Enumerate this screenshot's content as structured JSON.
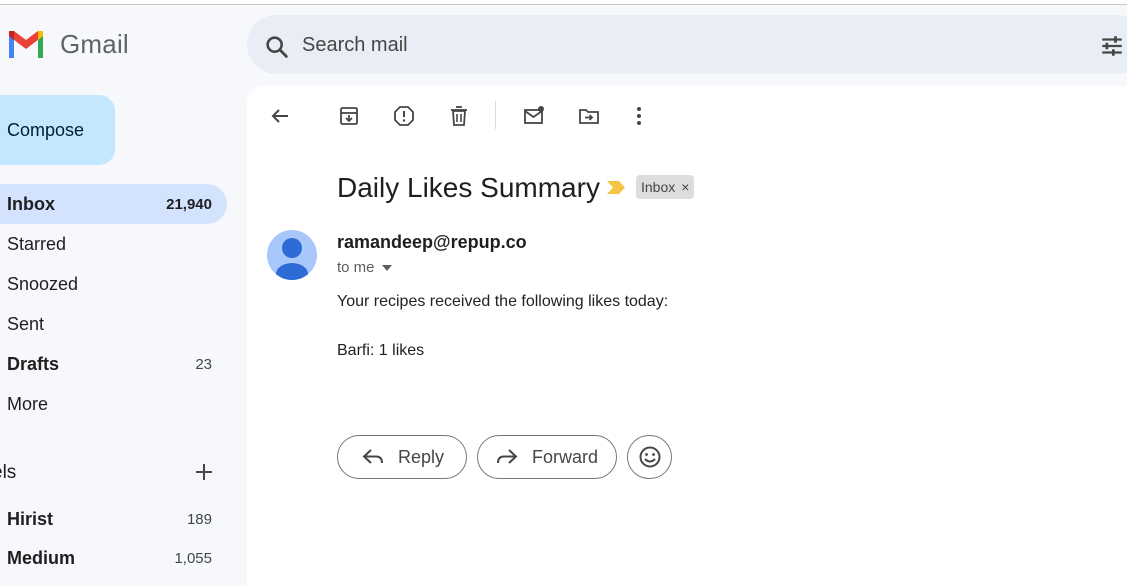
{
  "app": {
    "name": "Gmail"
  },
  "search": {
    "placeholder": "Search mail"
  },
  "sidebar": {
    "compose_label": "Compose",
    "items": [
      {
        "label": "Inbox",
        "count": "21,940"
      },
      {
        "label": "Starred",
        "count": ""
      },
      {
        "label": "Snoozed",
        "count": ""
      },
      {
        "label": "Sent",
        "count": ""
      },
      {
        "label": "Drafts",
        "count": "23"
      },
      {
        "label": "More",
        "count": ""
      }
    ],
    "labels_heading": "els",
    "labels": [
      {
        "label": "Hirist",
        "count": "189"
      },
      {
        "label": "Medium",
        "count": "1,055"
      }
    ]
  },
  "toolbar": {
    "icons": [
      "back-arrow-icon",
      "archive-icon",
      "report-spam-icon",
      "delete-icon",
      "mark-unread-icon",
      "move-to-icon",
      "more-vert-icon"
    ]
  },
  "message": {
    "subject": "Daily Likes Summary",
    "label_chip": "Inbox",
    "label_chip_remove": "×",
    "sender": "ramandeep@repup.co",
    "recipient": "to me",
    "body_line1": "Your recipes received the following likes today:",
    "body_line2": "Barfi: 1 likes"
  },
  "actions": {
    "reply": "Reply",
    "forward": "Forward"
  },
  "colors": {
    "background": "#f6f8fc",
    "compose": "#c2e7ff",
    "active_nav": "#d3e3fd",
    "search_bg": "#e9eef6",
    "importance_marker": "#f4c542"
  }
}
